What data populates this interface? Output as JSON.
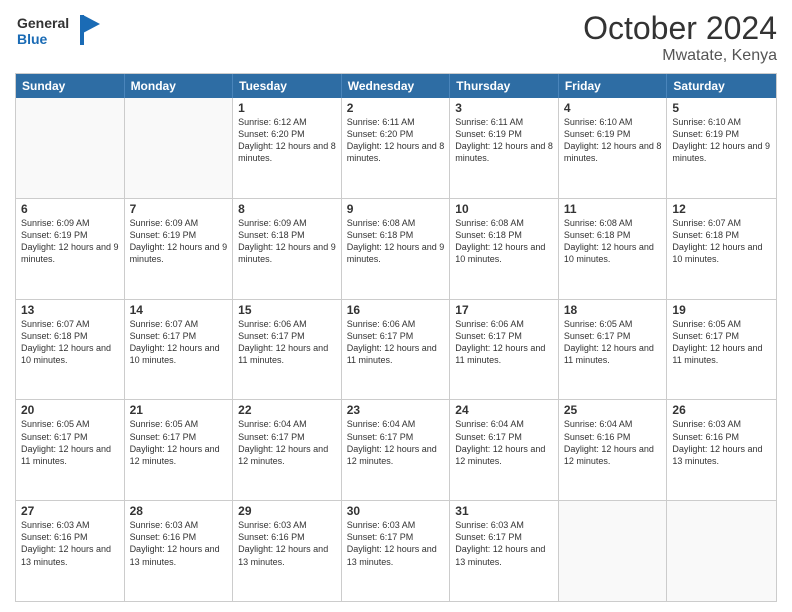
{
  "logo": {
    "line1": "General",
    "line2": "Blue"
  },
  "title": "October 2024",
  "location": "Mwatate, Kenya",
  "days_of_week": [
    "Sunday",
    "Monday",
    "Tuesday",
    "Wednesday",
    "Thursday",
    "Friday",
    "Saturday"
  ],
  "weeks": [
    [
      {
        "day": "",
        "info": ""
      },
      {
        "day": "",
        "info": ""
      },
      {
        "day": "1",
        "info": "Sunrise: 6:12 AM\nSunset: 6:20 PM\nDaylight: 12 hours and 8 minutes."
      },
      {
        "day": "2",
        "info": "Sunrise: 6:11 AM\nSunset: 6:20 PM\nDaylight: 12 hours and 8 minutes."
      },
      {
        "day": "3",
        "info": "Sunrise: 6:11 AM\nSunset: 6:19 PM\nDaylight: 12 hours and 8 minutes."
      },
      {
        "day": "4",
        "info": "Sunrise: 6:10 AM\nSunset: 6:19 PM\nDaylight: 12 hours and 8 minutes."
      },
      {
        "day": "5",
        "info": "Sunrise: 6:10 AM\nSunset: 6:19 PM\nDaylight: 12 hours and 9 minutes."
      }
    ],
    [
      {
        "day": "6",
        "info": "Sunrise: 6:09 AM\nSunset: 6:19 PM\nDaylight: 12 hours and 9 minutes."
      },
      {
        "day": "7",
        "info": "Sunrise: 6:09 AM\nSunset: 6:19 PM\nDaylight: 12 hours and 9 minutes."
      },
      {
        "day": "8",
        "info": "Sunrise: 6:09 AM\nSunset: 6:18 PM\nDaylight: 12 hours and 9 minutes."
      },
      {
        "day": "9",
        "info": "Sunrise: 6:08 AM\nSunset: 6:18 PM\nDaylight: 12 hours and 9 minutes."
      },
      {
        "day": "10",
        "info": "Sunrise: 6:08 AM\nSunset: 6:18 PM\nDaylight: 12 hours and 10 minutes."
      },
      {
        "day": "11",
        "info": "Sunrise: 6:08 AM\nSunset: 6:18 PM\nDaylight: 12 hours and 10 minutes."
      },
      {
        "day": "12",
        "info": "Sunrise: 6:07 AM\nSunset: 6:18 PM\nDaylight: 12 hours and 10 minutes."
      }
    ],
    [
      {
        "day": "13",
        "info": "Sunrise: 6:07 AM\nSunset: 6:18 PM\nDaylight: 12 hours and 10 minutes."
      },
      {
        "day": "14",
        "info": "Sunrise: 6:07 AM\nSunset: 6:17 PM\nDaylight: 12 hours and 10 minutes."
      },
      {
        "day": "15",
        "info": "Sunrise: 6:06 AM\nSunset: 6:17 PM\nDaylight: 12 hours and 11 minutes."
      },
      {
        "day": "16",
        "info": "Sunrise: 6:06 AM\nSunset: 6:17 PM\nDaylight: 12 hours and 11 minutes."
      },
      {
        "day": "17",
        "info": "Sunrise: 6:06 AM\nSunset: 6:17 PM\nDaylight: 12 hours and 11 minutes."
      },
      {
        "day": "18",
        "info": "Sunrise: 6:05 AM\nSunset: 6:17 PM\nDaylight: 12 hours and 11 minutes."
      },
      {
        "day": "19",
        "info": "Sunrise: 6:05 AM\nSunset: 6:17 PM\nDaylight: 12 hours and 11 minutes."
      }
    ],
    [
      {
        "day": "20",
        "info": "Sunrise: 6:05 AM\nSunset: 6:17 PM\nDaylight: 12 hours and 11 minutes."
      },
      {
        "day": "21",
        "info": "Sunrise: 6:05 AM\nSunset: 6:17 PM\nDaylight: 12 hours and 12 minutes."
      },
      {
        "day": "22",
        "info": "Sunrise: 6:04 AM\nSunset: 6:17 PM\nDaylight: 12 hours and 12 minutes."
      },
      {
        "day": "23",
        "info": "Sunrise: 6:04 AM\nSunset: 6:17 PM\nDaylight: 12 hours and 12 minutes."
      },
      {
        "day": "24",
        "info": "Sunrise: 6:04 AM\nSunset: 6:17 PM\nDaylight: 12 hours and 12 minutes."
      },
      {
        "day": "25",
        "info": "Sunrise: 6:04 AM\nSunset: 6:16 PM\nDaylight: 12 hours and 12 minutes."
      },
      {
        "day": "26",
        "info": "Sunrise: 6:03 AM\nSunset: 6:16 PM\nDaylight: 12 hours and 13 minutes."
      }
    ],
    [
      {
        "day": "27",
        "info": "Sunrise: 6:03 AM\nSunset: 6:16 PM\nDaylight: 12 hours and 13 minutes."
      },
      {
        "day": "28",
        "info": "Sunrise: 6:03 AM\nSunset: 6:16 PM\nDaylight: 12 hours and 13 minutes."
      },
      {
        "day": "29",
        "info": "Sunrise: 6:03 AM\nSunset: 6:16 PM\nDaylight: 12 hours and 13 minutes."
      },
      {
        "day": "30",
        "info": "Sunrise: 6:03 AM\nSunset: 6:17 PM\nDaylight: 12 hours and 13 minutes."
      },
      {
        "day": "31",
        "info": "Sunrise: 6:03 AM\nSunset: 6:17 PM\nDaylight: 12 hours and 13 minutes."
      },
      {
        "day": "",
        "info": ""
      },
      {
        "day": "",
        "info": ""
      }
    ]
  ]
}
